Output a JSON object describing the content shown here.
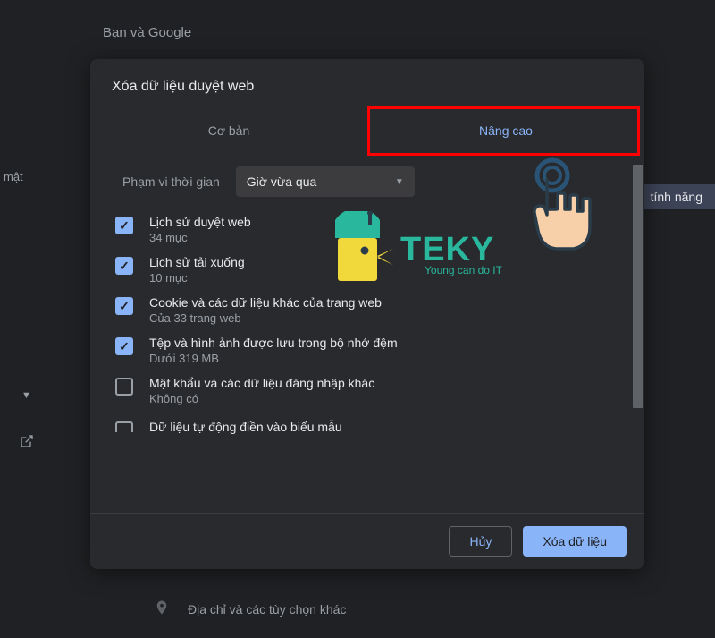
{
  "background": {
    "header": "Bạn và Google",
    "sidebar_item": "mật",
    "right_pill": "tính năng",
    "bottom": "Địa chỉ và các tùy chọn khác"
  },
  "dialog": {
    "title": "Xóa dữ liệu duyệt web",
    "tabs": {
      "basic": "Cơ bản",
      "advanced": "Nâng cao"
    },
    "time_range": {
      "label": "Phạm vi thời gian",
      "value": "Giờ vừa qua"
    },
    "items": [
      {
        "title": "Lịch sử duyệt web",
        "sub": "34 mục",
        "checked": true
      },
      {
        "title": "Lịch sử tải xuống",
        "sub": "10 mục",
        "checked": true
      },
      {
        "title": "Cookie và các dữ liệu khác của trang web",
        "sub": "Của 33 trang web",
        "checked": true
      },
      {
        "title": "Tệp và hình ảnh được lưu trong bộ nhớ đệm",
        "sub": "Dưới 319 MB",
        "checked": true
      },
      {
        "title": "Mật khẩu và các dữ liệu đăng nhập khác",
        "sub": "Không có",
        "checked": false
      },
      {
        "title": "Dữ liệu tự động điền vào biểu mẫu",
        "sub": "",
        "checked": false
      }
    ],
    "footer": {
      "cancel": "Hủy",
      "confirm": "Xóa dữ liệu"
    }
  },
  "overlay": {
    "logo_text": "TEKY",
    "logo_sub": "Young can do IT"
  }
}
